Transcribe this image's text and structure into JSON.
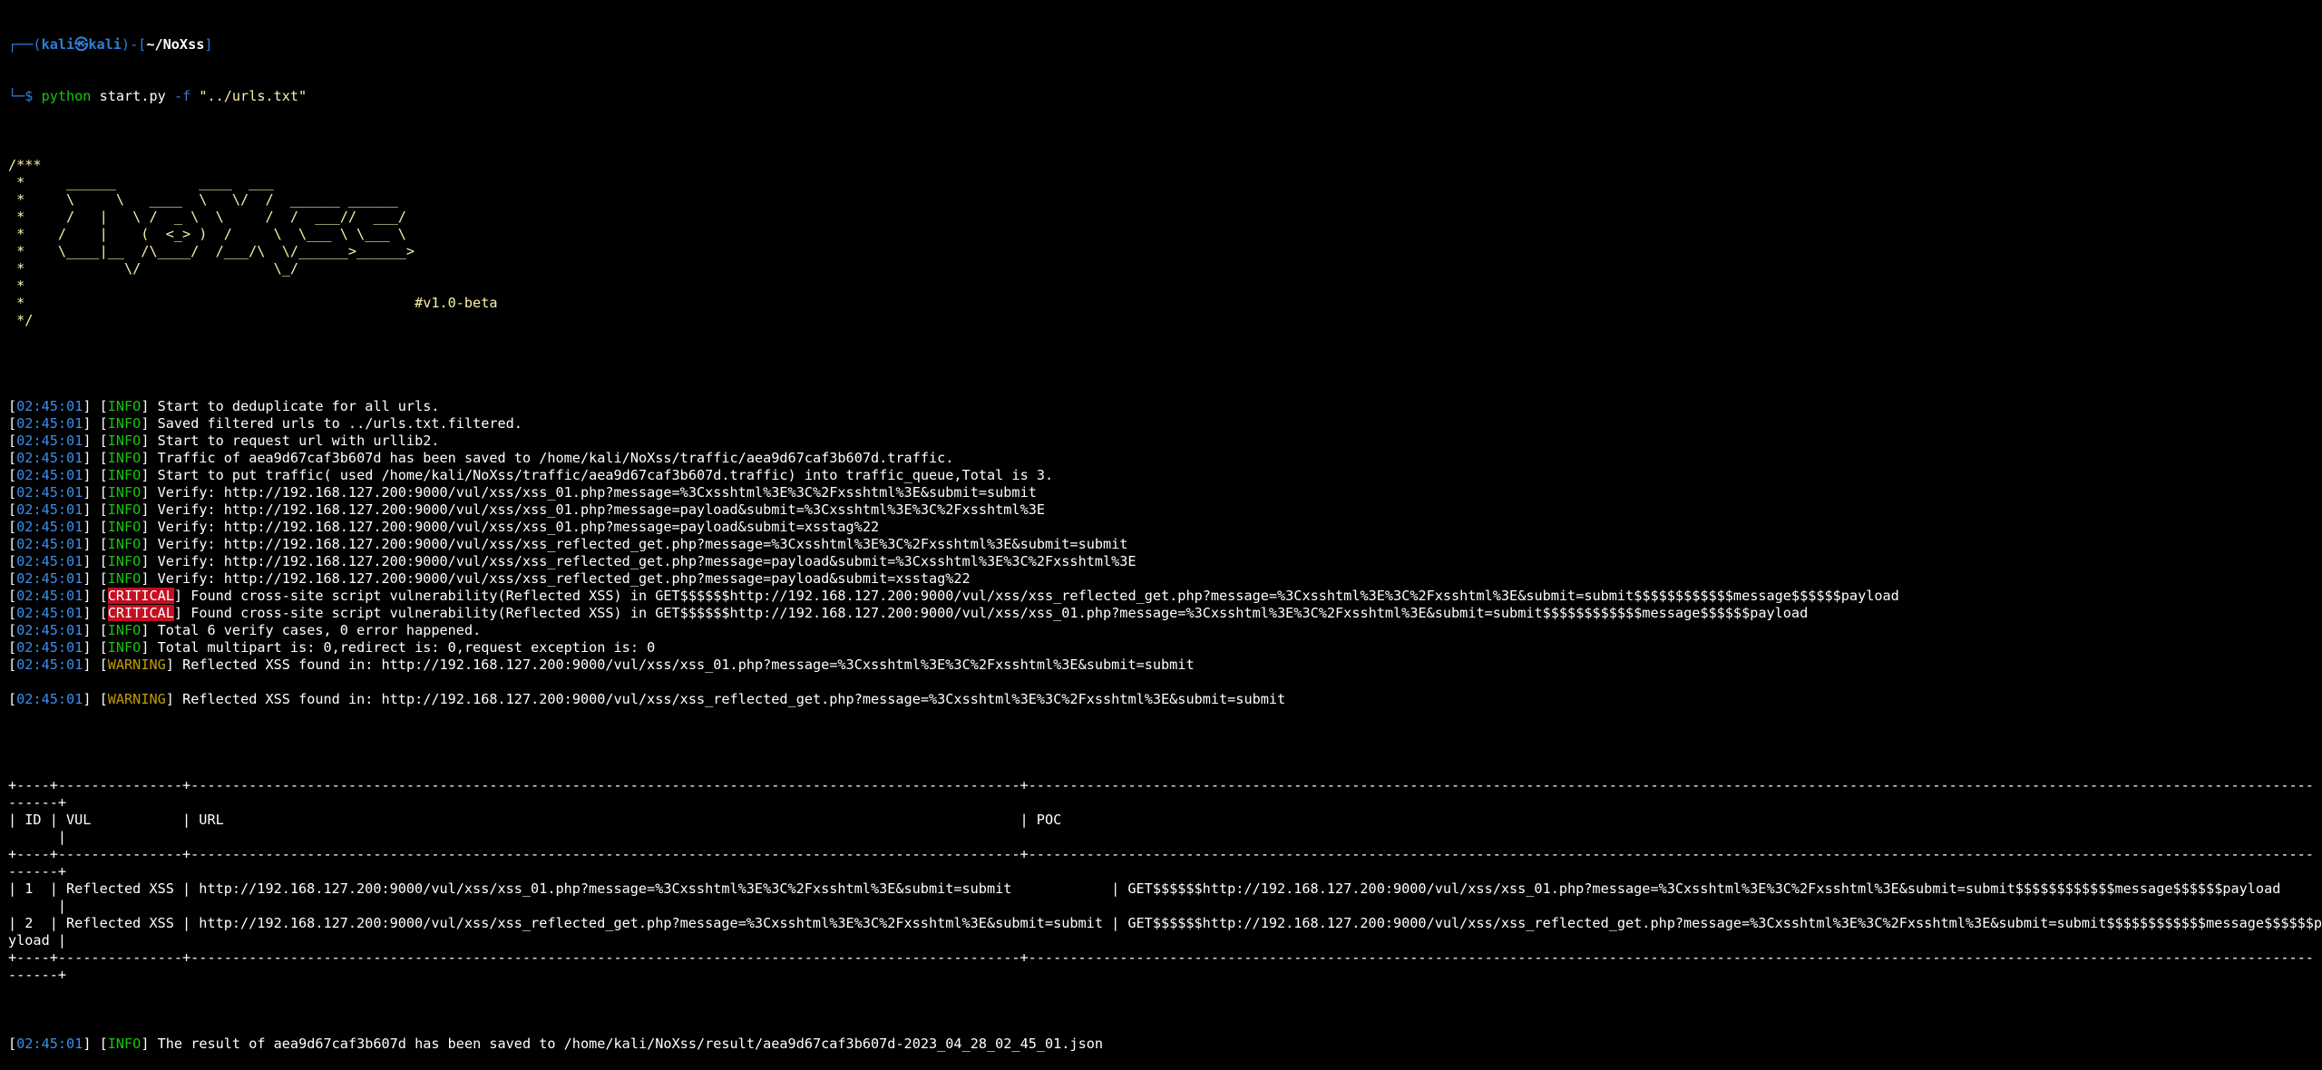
{
  "prompt": {
    "line1_prefix": "┌──(",
    "user_host": "kali㉿kali",
    "line1_mid": ")-[",
    "cwd": "~/NoXss",
    "line1_suffix": "]",
    "line2_prefix": "└─$ ",
    "command": "python",
    "command_rest": " start.py ",
    "flag": "-f",
    "arg": " \"../urls.txt\""
  },
  "banner": {
    "lines": [
      "/***",
      " *     ______          ____  ___",
      " *     \\     \\   ____  \\   \\/  /  ______ ______",
      " *     /   |   \\ /  _ \\  \\     /  /  ___//  ___/",
      " *    /    |    (  <_> )  /     \\  \\___ \\ \\___ \\",
      " *    \\____|__  /\\____/  /___/\\  \\/______>______>",
      " *            \\/                \\_/",
      " *",
      " */"
    ],
    "version_prefix": " *                                               ",
    "version": "#v1.0-beta"
  },
  "log": [
    {
      "time": "02:45:01",
      "level": "INFO",
      "msg": " Start to deduplicate for all urls."
    },
    {
      "time": "02:45:01",
      "level": "INFO",
      "msg": " Saved filtered urls to ../urls.txt.filtered."
    },
    {
      "time": "02:45:01",
      "level": "INFO",
      "msg": " Start to request url with urllib2."
    },
    {
      "time": "02:45:01",
      "level": "INFO",
      "msg": " Traffic of aea9d67caf3b607d has been saved to /home/kali/NoXss/traffic/aea9d67caf3b607d.traffic."
    },
    {
      "time": "02:45:01",
      "level": "INFO",
      "msg": " Start to put traffic( used /home/kali/NoXss/traffic/aea9d67caf3b607d.traffic) into traffic_queue,Total is 3."
    },
    {
      "time": "02:45:01",
      "level": "INFO",
      "msg": " Verify: http://192.168.127.200:9000/vul/xss/xss_01.php?message=%3Cxsshtml%3E%3C%2Fxsshtml%3E&submit=submit"
    },
    {
      "time": "02:45:01",
      "level": "INFO",
      "msg": " Verify: http://192.168.127.200:9000/vul/xss/xss_01.php?message=payload&submit=%3Cxsshtml%3E%3C%2Fxsshtml%3E"
    },
    {
      "time": "02:45:01",
      "level": "INFO",
      "msg": " Verify: http://192.168.127.200:9000/vul/xss/xss_01.php?message=payload&submit=xsstag%22"
    },
    {
      "time": "02:45:01",
      "level": "INFO",
      "msg": " Verify: http://192.168.127.200:9000/vul/xss/xss_reflected_get.php?message=%3Cxsshtml%3E%3C%2Fxsshtml%3E&submit=submit"
    },
    {
      "time": "02:45:01",
      "level": "INFO",
      "msg": " Verify: http://192.168.127.200:9000/vul/xss/xss_reflected_get.php?message=payload&submit=%3Cxsshtml%3E%3C%2Fxsshtml%3E"
    },
    {
      "time": "02:45:01",
      "level": "INFO",
      "msg": " Verify: http://192.168.127.200:9000/vul/xss/xss_reflected_get.php?message=payload&submit=xsstag%22"
    },
    {
      "time": "02:45:01",
      "level": "CRITICAL",
      "msg": " Found cross-site script vulnerability(Reflected XSS) in GET$$$$$$http://192.168.127.200:9000/vul/xss/xss_reflected_get.php?message=%3Cxsshtml%3E%3C%2Fxsshtml%3E&submit=submit$$$$$$$$$$$$message$$$$$$payload"
    },
    {
      "time": "02:45:01",
      "level": "CRITICAL",
      "msg": " Found cross-site script vulnerability(Reflected XSS) in GET$$$$$$http://192.168.127.200:9000/vul/xss/xss_01.php?message=%3Cxsshtml%3E%3C%2Fxsshtml%3E&submit=submit$$$$$$$$$$$$message$$$$$$payload"
    },
    {
      "time": "02:45:01",
      "level": "INFO",
      "msg": " Total 6 verify cases, 0 error happened."
    },
    {
      "time": "02:45:01",
      "level": "INFO",
      "msg": " Total multipart is: 0,redirect is: 0,request exception is: 0"
    },
    {
      "time": "02:45:01",
      "level": "WARNING",
      "msg": " Reflected XSS found in: http://192.168.127.200:9000/vul/xss/xss_01.php?message=%3Cxsshtml%3E%3C%2Fxsshtml%3E&submit=submit"
    },
    {
      "blank": true
    },
    {
      "time": "02:45:01",
      "level": "WARNING",
      "msg": " Reflected XSS found in: http://192.168.127.200:9000/vul/xss/xss_reflected_get.php?message=%3Cxsshtml%3E%3C%2Fxsshtml%3E&submit=submit"
    },
    {
      "blank": true
    }
  ],
  "table": {
    "lines": [
      "+----+---------------+----------------------------------------------------------------------------------------------------+-----------------------------------------------------------------------------------------------------------------------------------------------------------",
      "------+",
      "| ID | VUL           | URL                                                                                                | POC",
      "      |",
      "+----+---------------+----------------------------------------------------------------------------------------------------+-----------------------------------------------------------------------------------------------------------------------------------------------------------",
      "------+",
      "| 1  | Reflected XSS | http://192.168.127.200:9000/vul/xss/xss_01.php?message=%3Cxsshtml%3E%3C%2Fxsshtml%3E&submit=submit            | GET$$$$$$http://192.168.127.200:9000/vul/xss/xss_01.php?message=%3Cxsshtml%3E%3C%2Fxsshtml%3E&submit=submit$$$$$$$$$$$$message$$$$$$payload",
      "      |",
      "| 2  | Reflected XSS | http://192.168.127.200:9000/vul/xss/xss_reflected_get.php?message=%3Cxsshtml%3E%3C%2Fxsshtml%3E&submit=submit | GET$$$$$$http://192.168.127.200:9000/vul/xss/xss_reflected_get.php?message=%3Cxsshtml%3E%3C%2Fxsshtml%3E&submit=submit$$$$$$$$$$$$message$$$$$$pa",
      "yload |",
      "+----+---------------+----------------------------------------------------------------------------------------------------+-----------------------------------------------------------------------------------------------------------------------------------------------------------",
      "------+"
    ]
  },
  "final_log": {
    "time": "02:45:01",
    "level": "INFO",
    "msg": " The result of aea9d67caf3b607d has been saved to /home/kali/NoXss/result/aea9d67caf3b607d-2023_04_28_02_45_01.json"
  },
  "colors": {
    "background": "#000000",
    "text": "#ffffff",
    "prompt_blue": "#2f7fd6",
    "info_green": "#16c60c",
    "timestamp_blue": "#3b8eea",
    "banner_yellow": "#f9f1a5",
    "warning_yellow": "#c19c00",
    "critical_red": "#c50f1f"
  }
}
